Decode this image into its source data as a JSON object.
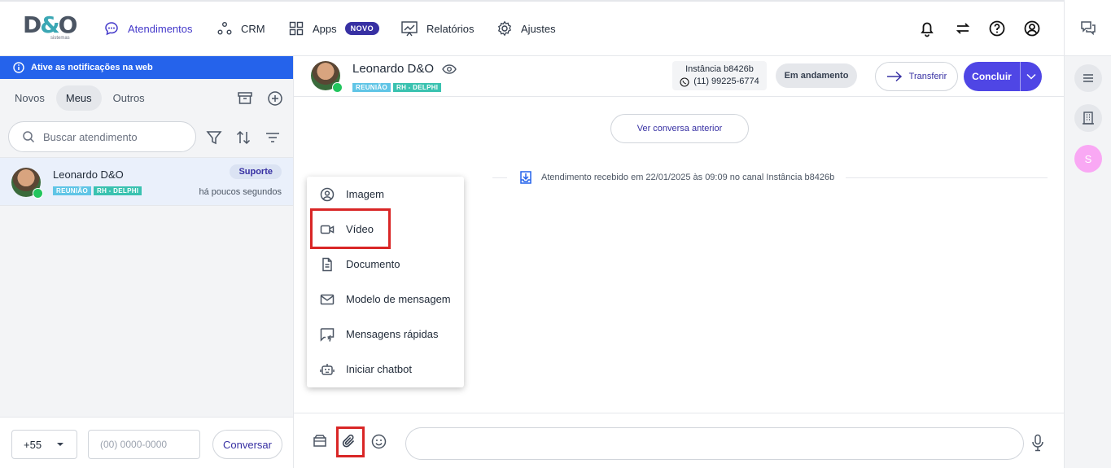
{
  "brand": {
    "logo_text": "D&O",
    "logo_sub": "sistemas"
  },
  "nav": {
    "items": [
      {
        "label": "Atendimentos",
        "icon": "chat-bubble-icon",
        "active": true
      },
      {
        "label": "CRM",
        "icon": "nodes-icon"
      },
      {
        "label": "Apps",
        "icon": "grid-icon",
        "badge": "NOVO"
      },
      {
        "label": "Relatórios",
        "icon": "chart-icon"
      },
      {
        "label": "Ajustes",
        "icon": "gear-icon"
      }
    ]
  },
  "notification_bar": {
    "text": "Ative as notificações na web"
  },
  "left_tabs": [
    "Novos",
    "Meus",
    "Outros"
  ],
  "active_tab": "Meus",
  "search": {
    "placeholder": "Buscar atendimento"
  },
  "conversation": {
    "name": "Leonardo D&O",
    "tags": [
      "REUNIÃO",
      "RH - DELPHI"
    ],
    "queue": "Suporte",
    "time": "há poucos segundos"
  },
  "new_chat": {
    "ddi": "+55",
    "phone_placeholder": "(00) 0000-0000",
    "button": "Conversar"
  },
  "chat_header": {
    "contact_name": "Leonardo D&O",
    "tags": [
      "REUNIÃO",
      "RH - DELPHI"
    ],
    "instance_name": "Instância b8426b",
    "instance_phone": "(11) 99225-6774",
    "status": "Em andamento",
    "transfer_label": "Transferir",
    "conclude_label": "Concluir"
  },
  "chat_body": {
    "previous_button": "Ver conversa anterior",
    "event_text": "Atendimento recebido em 22/01/2025 às 09:09 no canal Instância b8426b"
  },
  "attach_menu": [
    {
      "label": "Imagem",
      "icon": "image-icon"
    },
    {
      "label": "Vídeo",
      "icon": "video-icon"
    },
    {
      "label": "Documento",
      "icon": "document-icon"
    },
    {
      "label": "Modelo de mensagem",
      "icon": "mail-icon"
    },
    {
      "label": "Mensagens rápidas",
      "icon": "quick-message-icon"
    },
    {
      "label": "Iniciar chatbot",
      "icon": "robot-icon"
    }
  ],
  "rail": {
    "avatar_initial": "S"
  },
  "colors": {
    "primary": "#4f46e5",
    "notif": "#2563eb",
    "highlight": "#d92626"
  }
}
